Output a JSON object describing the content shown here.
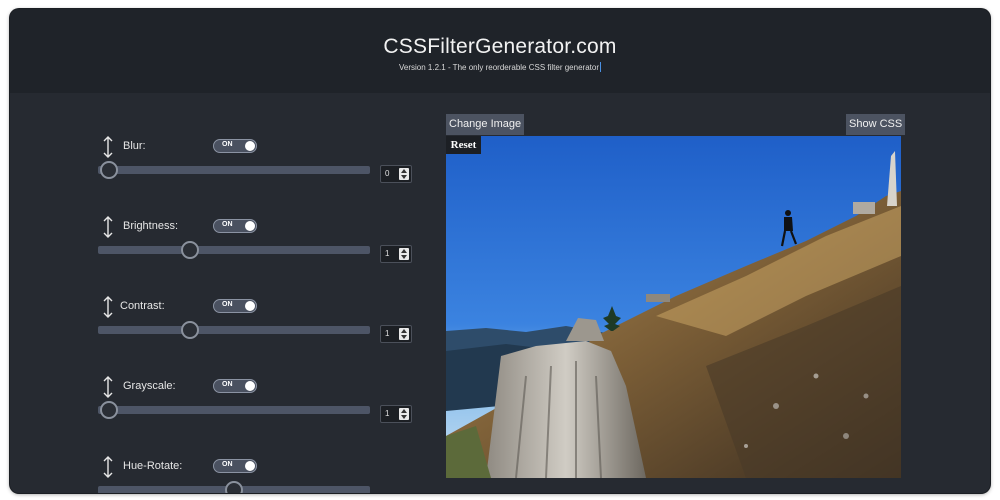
{
  "header": {
    "title": "CSSFilterGenerator.com",
    "subtitle": "Version 1.2.1 - The only reorderable CSS filter generator"
  },
  "filters": [
    {
      "label": "Blur:",
      "toggle": "ON",
      "value": "0",
      "slider_fraction": 0.04
    },
    {
      "label": "Brightness:",
      "toggle": "ON",
      "value": "1",
      "slider_fraction": 0.34
    },
    {
      "label": "Contrast:",
      "toggle": "ON",
      "value": "1",
      "slider_fraction": 0.34
    },
    {
      "label": "Grayscale:",
      "toggle": "ON",
      "value": "1",
      "slider_fraction": 0.04
    },
    {
      "label": "Hue-Rotate:",
      "toggle": "ON",
      "value": "",
      "slider_fraction": 0.5
    }
  ],
  "preview": {
    "change_image_label": "Change Image",
    "show_css_label": "Show CSS",
    "reset_label": "Reset"
  },
  "colors": {
    "frame": "#262a31",
    "header": "#1f2329",
    "slider_track": "#4d5566",
    "button": "#4c5361",
    "sky": "#2f6fd0"
  },
  "icons": {
    "reorder": "vertical-double-arrow-icon"
  }
}
